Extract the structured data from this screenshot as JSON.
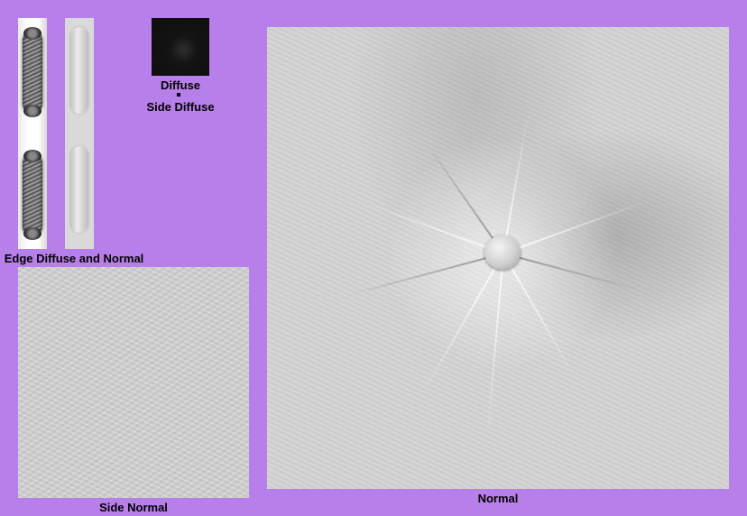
{
  "labels": {
    "diffuse": "Diffuse",
    "side_diffuse": "Side Diffuse",
    "edge_diffuse_and_normal": "Edge Diffuse and Normal",
    "side_normal": "Side Normal",
    "normal": "Normal"
  },
  "colors": {
    "background": "#b77fe9"
  }
}
